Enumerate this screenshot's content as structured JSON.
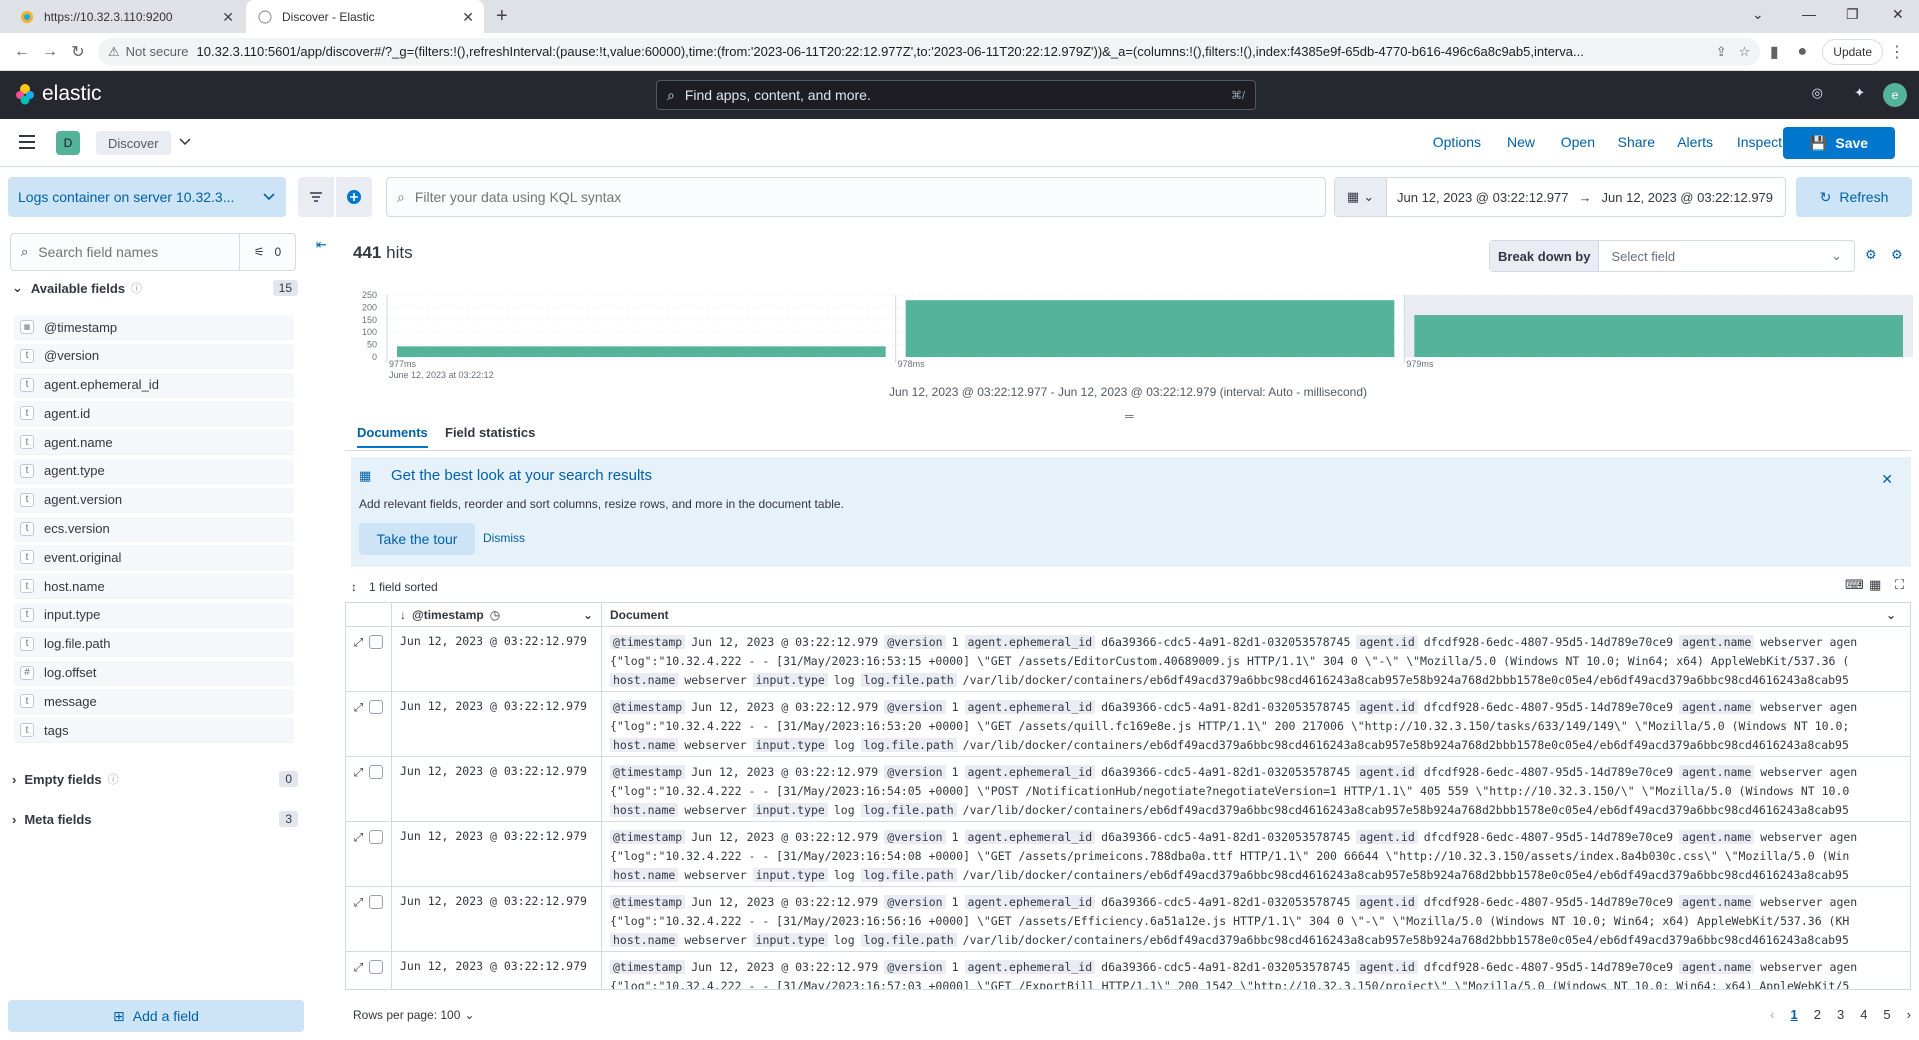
{
  "browser": {
    "tabs": [
      {
        "title": "https://10.32.3.110:9200"
      },
      {
        "title": "Discover - Elastic"
      }
    ],
    "security": "Not secure",
    "url": "10.32.3.110:5601/app/discover#/?_g=(filters:!(),refreshInterval:(pause:!t,value:60000),time:(from:'2023-06-11T20:22:12.977Z',to:'2023-06-11T20:22:12.979Z'))&_a=(columns:!(),filters:!(),index:f4385e9f-65db-4770-b616-496c6a8c9ab5,interva...",
    "update_label": "Update"
  },
  "header": {
    "brand": "elastic",
    "search_placeholder": "Find apps, content, and more.",
    "search_shortcut": "⌘/",
    "avatar_initial": "e"
  },
  "appbar": {
    "space_initial": "D",
    "breadcrumb": "Discover",
    "links": [
      "Options",
      "New",
      "Open",
      "Share",
      "Alerts",
      "Inspect"
    ],
    "save_label": "Save"
  },
  "query": {
    "data_view": "Logs container on server 10.32.3...",
    "kql_placeholder": "Filter your data using KQL syntax",
    "start": "Jun 12, 2023 @ 03:22:12.977",
    "end": "Jun 12, 2023 @ 03:22:12.979",
    "refresh_label": "Refresh"
  },
  "sidebar": {
    "search_placeholder": "Search field names",
    "filter_count": "0",
    "available_label": "Available fields",
    "available_count": "15",
    "fields": [
      {
        "name": "@timestamp",
        "type": "date"
      },
      {
        "name": "@version",
        "type": "t"
      },
      {
        "name": "agent.ephemeral_id",
        "type": "t"
      },
      {
        "name": "agent.id",
        "type": "t"
      },
      {
        "name": "agent.name",
        "type": "t"
      },
      {
        "name": "agent.type",
        "type": "t"
      },
      {
        "name": "agent.version",
        "type": "t"
      },
      {
        "name": "ecs.version",
        "type": "t"
      },
      {
        "name": "event.original",
        "type": "t"
      },
      {
        "name": "host.name",
        "type": "t"
      },
      {
        "name": "input.type",
        "type": "t"
      },
      {
        "name": "log.file.path",
        "type": "t"
      },
      {
        "name": "log.offset",
        "type": "#"
      },
      {
        "name": "message",
        "type": "t"
      },
      {
        "name": "tags",
        "type": "t"
      }
    ],
    "empty_label": "Empty fields",
    "empty_count": "0",
    "meta_label": "Meta fields",
    "meta_count": "3",
    "add_field_label": "Add a field"
  },
  "main": {
    "hits_count": "441",
    "hits_label": "hits",
    "breakdown_label": "Break down by",
    "breakdown_placeholder": "Select field",
    "chart_caption": "Jun 12, 2023 @ 03:22:12.977 - Jun 12, 2023 @ 03:22:12.979 (interval: Auto - millisecond)",
    "tabs": [
      "Documents",
      "Field statistics"
    ],
    "callout_title": "Get the best look at your search results",
    "callout_body": "Add relevant fields, reorder and sort columns, resize rows, and more in the document table.",
    "tour_label": "Take the tour",
    "dismiss_label": "Dismiss",
    "sorted_label": "1 field sorted",
    "col_timestamp": "@timestamp",
    "col_document": "Document",
    "rows_per_page": "Rows per page: 100",
    "pages": [
      "1",
      "2",
      "3",
      "4",
      "5"
    ]
  },
  "rows": [
    {
      "ts": "Jun 12, 2023 @ 03:22:12.979",
      "line2": "{\"log\":\"10.32.4.222 - - [31/May/2023:16:53:15 +0000] \\\"GET /assets/EditorCustom.40689009.js HTTP/1.1\\\" 304 0 \\\"-\\\" \\\"Mozilla/5.0 (Windows NT 10.0; Win64; x64) AppleWebKit/537.36 ("
    },
    {
      "ts": "Jun 12, 2023 @ 03:22:12.979",
      "line2": "{\"log\":\"10.32.4.222 - - [31/May/2023:16:53:20 +0000] \\\"GET /assets/quill.fc169e8e.js HTTP/1.1\\\" 200 217006 \\\"http://10.32.3.150/tasks/633/149/149\\\" \\\"Mozilla/5.0 (Windows NT 10.0;"
    },
    {
      "ts": "Jun 12, 2023 @ 03:22:12.979",
      "line2": "{\"log\":\"10.32.4.222 - - [31/May/2023:16:54:05 +0000] \\\"POST /NotificationHub/negotiate?negotiateVersion=1 HTTP/1.1\\\" 405 559 \\\"http://10.32.3.150/\\\" \\\"Mozilla/5.0 (Windows NT 10.0"
    },
    {
      "ts": "Jun 12, 2023 @ 03:22:12.979",
      "line2": "{\"log\":\"10.32.4.222 - - [31/May/2023:16:54:08 +0000] \\\"GET /assets/primeicons.788dba0a.ttf HTTP/1.1\\\" 200 66644 \\\"http://10.32.3.150/assets/index.8a4b030c.css\\\" \\\"Mozilla/5.0 (Win"
    },
    {
      "ts": "Jun 12, 2023 @ 03:22:12.979",
      "line2": "{\"log\":\"10.32.4.222 - - [31/May/2023:16:56:16 +0000] \\\"GET /assets/Efficiency.6a51a12e.js HTTP/1.1\\\" 304 0 \\\"-\\\" \\\"Mozilla/5.0 (Windows NT 10.0; Win64; x64) AppleWebKit/537.36 (KH"
    },
    {
      "ts": "Jun 12, 2023 @ 03:22:12.979",
      "line2": "{\"log\":\"10.32.4.222 - - [31/May/2023:16:57:03 +0000] \\\"GET /ExportBill HTTP/1.1\\\" 200 1542 \\\"http://10.32.3.150/project\\\" \\\"Mozilla/5.0 (Windows NT 10.0; Win64; x64) AppleWebKit/5"
    }
  ],
  "row_common": {
    "k_timestamp": "@timestamp",
    "v_timestamp": "Jun 12, 2023 @ 03:22:12.979",
    "k_version": "@version",
    "v_version": "1",
    "k_ephemeral": "agent.ephemeral_id",
    "v_ephemeral": "d6a39366-cdc5-4a91-82d1-032053578745",
    "k_agentid": "agent.id",
    "v_agentid": "dfcdf928-6edc-4807-95d5-14d789e70ce9",
    "k_agentname": "agent.name",
    "v_agentname": "webserver agen",
    "k_host": "host.name",
    "v_host": "webserver",
    "k_input": "input.type",
    "v_input": "log",
    "k_path": "log.file.path",
    "v_path": "/var/lib/docker/containers/eb6df49acd379a6bbc98cd4616243a8cab957e58b924a768d2bbb1578e0c05e4/eb6df49acd379a6bbc98cd4616243a8cab95"
  },
  "chart_data": {
    "type": "bar",
    "categories": [
      "977ms",
      "978ms",
      "979ms"
    ],
    "values": [
      43,
      229,
      169
    ],
    "first_tick_sub": "June 12, 2023 at 03:22:12",
    "y_ticks": [
      0,
      50,
      100,
      150,
      200,
      250
    ],
    "ylim": [
      0,
      250
    ],
    "color": "#54b399"
  }
}
